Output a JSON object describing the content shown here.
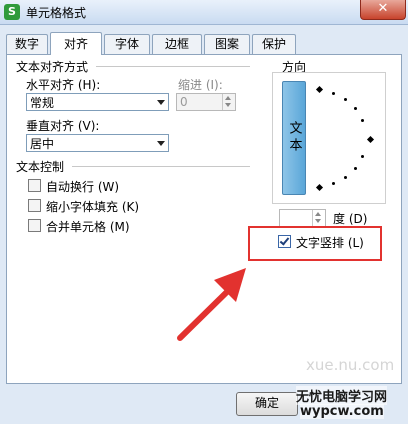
{
  "window": {
    "title": "单元格格式",
    "app_icon_letter": "S",
    "close_symbol": "✕"
  },
  "tabs": [
    {
      "label": "数字",
      "active": false
    },
    {
      "label": "对齐",
      "active": true
    },
    {
      "label": "字体",
      "active": false
    },
    {
      "label": "边框",
      "active": false
    },
    {
      "label": "图案",
      "active": false
    },
    {
      "label": "保护",
      "active": false
    }
  ],
  "alignment": {
    "group_label": "文本对齐方式",
    "horizontal_label": "水平对齐 (H):",
    "horizontal_value": "常规",
    "indent_label": "缩进 (I):",
    "indent_value": "0",
    "vertical_label": "垂直对齐 (V):",
    "vertical_value": "居中"
  },
  "text_control": {
    "group_label": "文本控制",
    "options": [
      {
        "label": "自动换行 (W)",
        "checked": false
      },
      {
        "label": "缩小字体填充 (K)",
        "checked": false
      },
      {
        "label": "合并单元格 (M)",
        "checked": false
      }
    ]
  },
  "orientation": {
    "group_label": "方向",
    "vertical_text_button": "文本",
    "degree_value": "",
    "degree_label": "度 (D)",
    "vertical_text_checkbox": {
      "label": "文字竖排 (L)",
      "checked": true
    }
  },
  "buttons": {
    "ok": "确定"
  },
  "watermark": {
    "site": "无忧电脑学习网",
    "url": "wypcw.com",
    "faint": "xue.nu.com"
  },
  "colors": {
    "highlight": "#e2322f",
    "vertical_button": "#5aa6d8",
    "dialog_bg": "#dfe9f5"
  }
}
